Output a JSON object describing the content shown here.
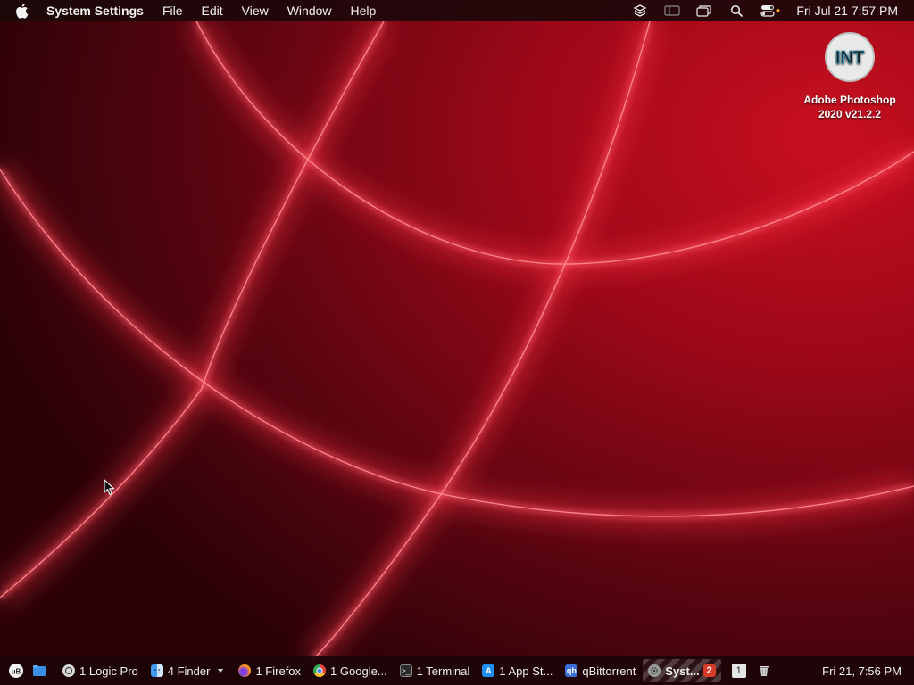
{
  "menubar": {
    "app_name": "System Settings",
    "menus": [
      "File",
      "Edit",
      "View",
      "Window",
      "Help"
    ],
    "status_icons": [
      "layers-icon",
      "sidebar-icon",
      "windows-icon",
      "search-icon",
      "control-center-icon"
    ],
    "clock": "Fri Jul 21  7:57 PM"
  },
  "desktop_icons": [
    {
      "name": "photoshop-installer",
      "label_line1": "Adobe Photoshop",
      "label_line2": "2020 v21.2.2",
      "logo_text": "INT"
    }
  ],
  "taskbar": {
    "left_icons": [
      "ublock-icon",
      "folder-icon"
    ],
    "items": [
      {
        "label": "1 Logic Pro",
        "icon": "logic-pro-icon",
        "active": false
      },
      {
        "label": "4 Finder",
        "icon": "finder-icon",
        "active": false,
        "dropdown": true
      },
      {
        "label": "1 Firefox",
        "icon": "firefox-icon",
        "active": false
      },
      {
        "label": "1 Google...",
        "icon": "chrome-icon",
        "active": false
      },
      {
        "label": "1 Terminal",
        "icon": "terminal-icon",
        "active": false
      },
      {
        "label": "1 App St...",
        "icon": "app-store-icon",
        "active": false
      },
      {
        "label": "qBittorrent",
        "icon": "qbittorrent-icon",
        "active": false
      },
      {
        "label": "Syst...",
        "icon": "system-settings-icon",
        "active": true,
        "badge": "2"
      }
    ],
    "workspace_number": "1",
    "clock": "Fri 21, 7:56 PM"
  },
  "colors": {
    "wallpaper_base": "#a0091a",
    "wallpaper_glow": "#ff3a4e",
    "menubar_bg": "#1c080a",
    "badge": "#d83a2a"
  }
}
